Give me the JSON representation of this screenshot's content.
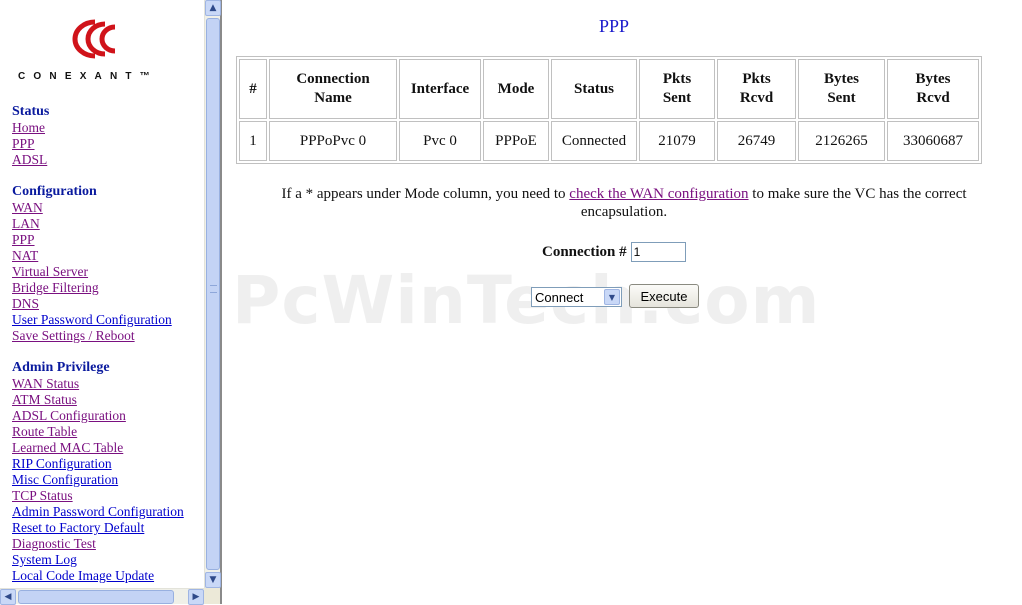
{
  "brand": {
    "name": "CONEXANT™",
    "logo_icon": "conexant-logo-icon"
  },
  "sidebar": {
    "sections": [
      {
        "heading": "Status",
        "items": [
          {
            "label": "Home",
            "visited": true
          },
          {
            "label": "PPP",
            "visited": true
          },
          {
            "label": "ADSL",
            "visited": true
          }
        ]
      },
      {
        "heading": "Configuration",
        "items": [
          {
            "label": "WAN",
            "visited": true
          },
          {
            "label": "LAN",
            "visited": true
          },
          {
            "label": "PPP",
            "visited": true
          },
          {
            "label": "NAT",
            "visited": true
          },
          {
            "label": "Virtual Server",
            "visited": true
          },
          {
            "label": "Bridge Filtering",
            "visited": true
          },
          {
            "label": "DNS",
            "visited": true
          },
          {
            "label": "User Password Configuration",
            "visited": false
          },
          {
            "label": "Save Settings / Reboot",
            "visited": true
          }
        ]
      },
      {
        "heading": "Admin Privilege",
        "items": [
          {
            "label": "WAN Status",
            "visited": true
          },
          {
            "label": "ATM Status",
            "visited": true
          },
          {
            "label": "ADSL Configuration",
            "visited": true
          },
          {
            "label": "Route Table",
            "visited": true
          },
          {
            "label": "Learned MAC Table",
            "visited": true
          },
          {
            "label": "RIP Configuration",
            "visited": false
          },
          {
            "label": "Misc Configuration",
            "visited": false
          },
          {
            "label": "TCP Status",
            "visited": true
          },
          {
            "label": "Admin Password Configuration",
            "visited": false
          },
          {
            "label": "Reset to Factory Default",
            "visited": false
          },
          {
            "label": "Diagnostic Test",
            "visited": true
          },
          {
            "label": "System Log",
            "visited": false
          },
          {
            "label": "Local Code Image Update",
            "visited": false
          }
        ]
      }
    ]
  },
  "main": {
    "title": "PPP",
    "table": {
      "headers": [
        [
          "#"
        ],
        [
          "Connection",
          "Name"
        ],
        [
          "Interface"
        ],
        [
          "Mode"
        ],
        [
          "Status"
        ],
        [
          "Pkts",
          "Sent"
        ],
        [
          "Pkts",
          "Rcvd"
        ],
        [
          "Bytes",
          "Sent"
        ],
        [
          "Bytes",
          "Rcvd"
        ]
      ],
      "rows": [
        [
          "1",
          "PPPoPvc 0",
          "Pvc 0",
          "PPPoE",
          "Connected",
          "21079",
          "26749",
          "2126265",
          "33060687"
        ]
      ]
    },
    "note": {
      "before": "If a * appears under Mode column, you need to ",
      "link": "check the WAN configuration",
      "after": " to make sure the VC has the correct encapsulation."
    },
    "connection": {
      "label": "Connection #",
      "value": "1"
    },
    "action_select": {
      "value": "Connect"
    },
    "execute_label": "Execute",
    "watermark": "PcWinTech.com"
  },
  "colors": {
    "heading": "#0a1a9e",
    "title": "#1a1acc",
    "visited_link": "#7a1080",
    "link": "#0000cc",
    "logo_red": "#d0131a"
  }
}
